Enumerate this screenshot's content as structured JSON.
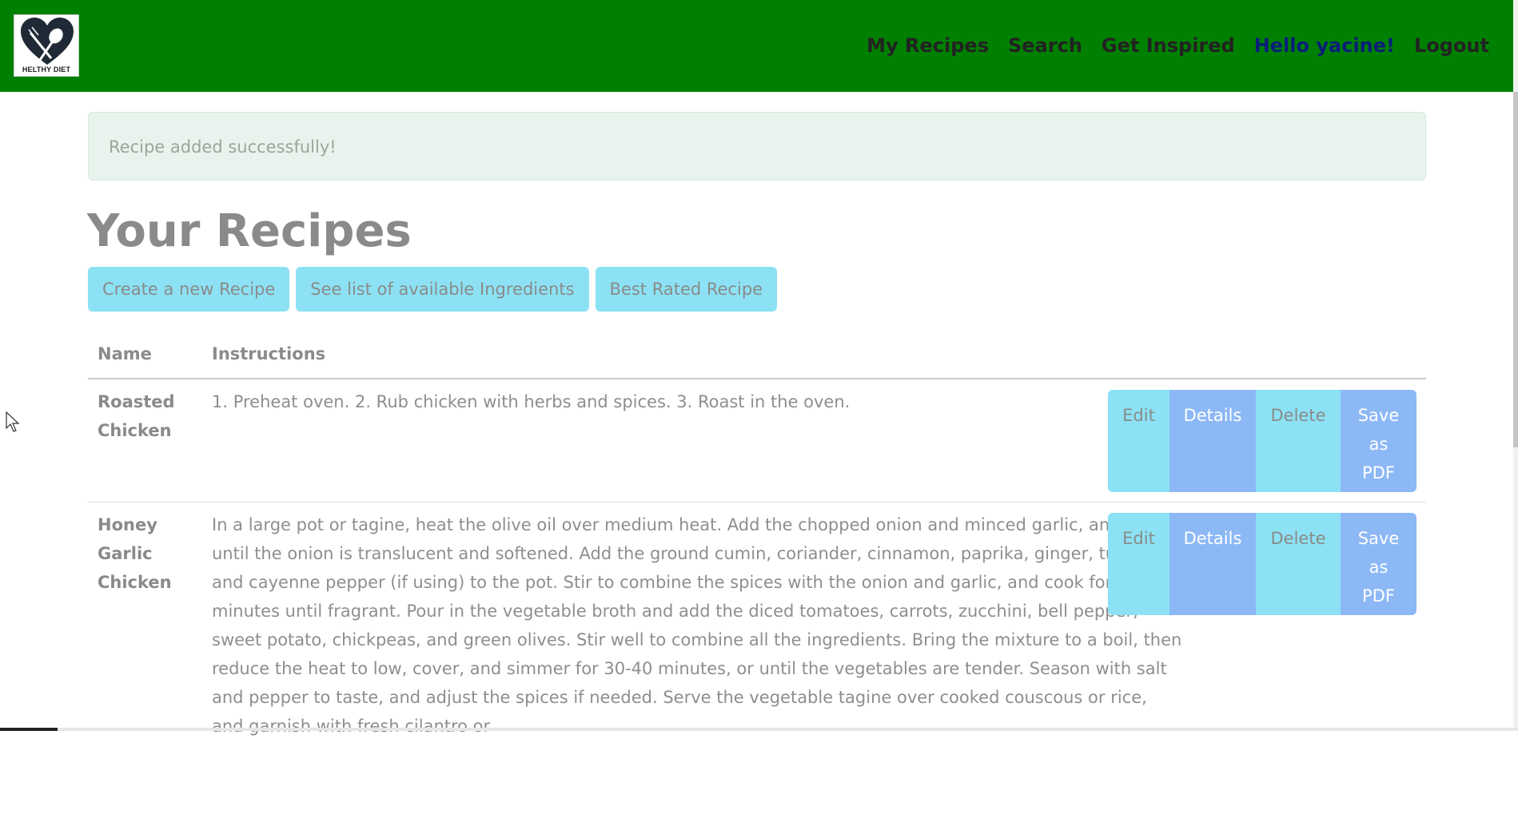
{
  "navbar": {
    "logo_text": "HELTHY DIET",
    "links": [
      "My Recipes",
      "Search",
      "Get Inspired"
    ],
    "greeting": "Hello yacine!",
    "logout": "Logout",
    "bg_color": "#008000"
  },
  "alert": {
    "message": "Recipe added successfully!"
  },
  "page_title": "Your Recipes",
  "buttons": {
    "create": "Create a new Recipe",
    "ingredients": "See list of available Ingredients",
    "best": "Best Rated Recipe"
  },
  "table": {
    "headers": {
      "name": "Name",
      "instructions": "Instructions"
    },
    "actions": {
      "edit": "Edit",
      "details": "Details",
      "delete": "Delete",
      "pdf_line1": "Save",
      "pdf_line2": "as",
      "pdf_line3": "PDF"
    },
    "rows": [
      {
        "name": "Roasted Chicken",
        "instructions": "1. Preheat oven. 2. Rub chicken with herbs and spices. 3. Roast in the oven."
      },
      {
        "name": "Honey Garlic Chicken",
        "instructions": "In a large pot or tagine, heat the olive oil over medium heat. Add the chopped onion and minced garlic, and sauté until the onion is translucent and softened. Add the ground cumin, coriander, cinnamon, paprika, ginger, turmeric, and cayenne pepper (if using) to the pot. Stir to combine the spices with the onion and garlic, and cook for 1-2 minutes until fragrant. Pour in the vegetable broth and add the diced tomatoes, carrots, zucchini, bell pepper, sweet potato, chickpeas, and green olives. Stir well to combine all the ingredients. Bring the mixture to a boil, then reduce the heat to low, cover, and simmer for 30-40 minutes, or until the vegetables are tender. Season with salt and pepper to taste, and adjust the spices if needed. Serve the vegetable tagine over cooked couscous or rice, and garnish with fresh cilantro or"
      }
    ]
  }
}
